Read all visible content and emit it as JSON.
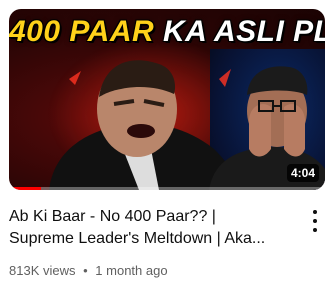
{
  "video": {
    "thumbnail_text_yellow": "400 PAAR",
    "thumbnail_text_white": "KA ASLI PLAN!",
    "duration": "4:04",
    "watch_progress_fraction": 0.1,
    "title_line1": "Ab Ki Baar - No 400 Paar?? |",
    "title_line2": "Supreme Leader's Meltdown | Aka...",
    "views": "813K views",
    "separator": "•",
    "age": "1 month ago"
  },
  "icons": {
    "more": "more-vertical-icon"
  },
  "colors": {
    "thumb_text_yellow": "#ffd21a",
    "progress_red": "#ff0000"
  }
}
